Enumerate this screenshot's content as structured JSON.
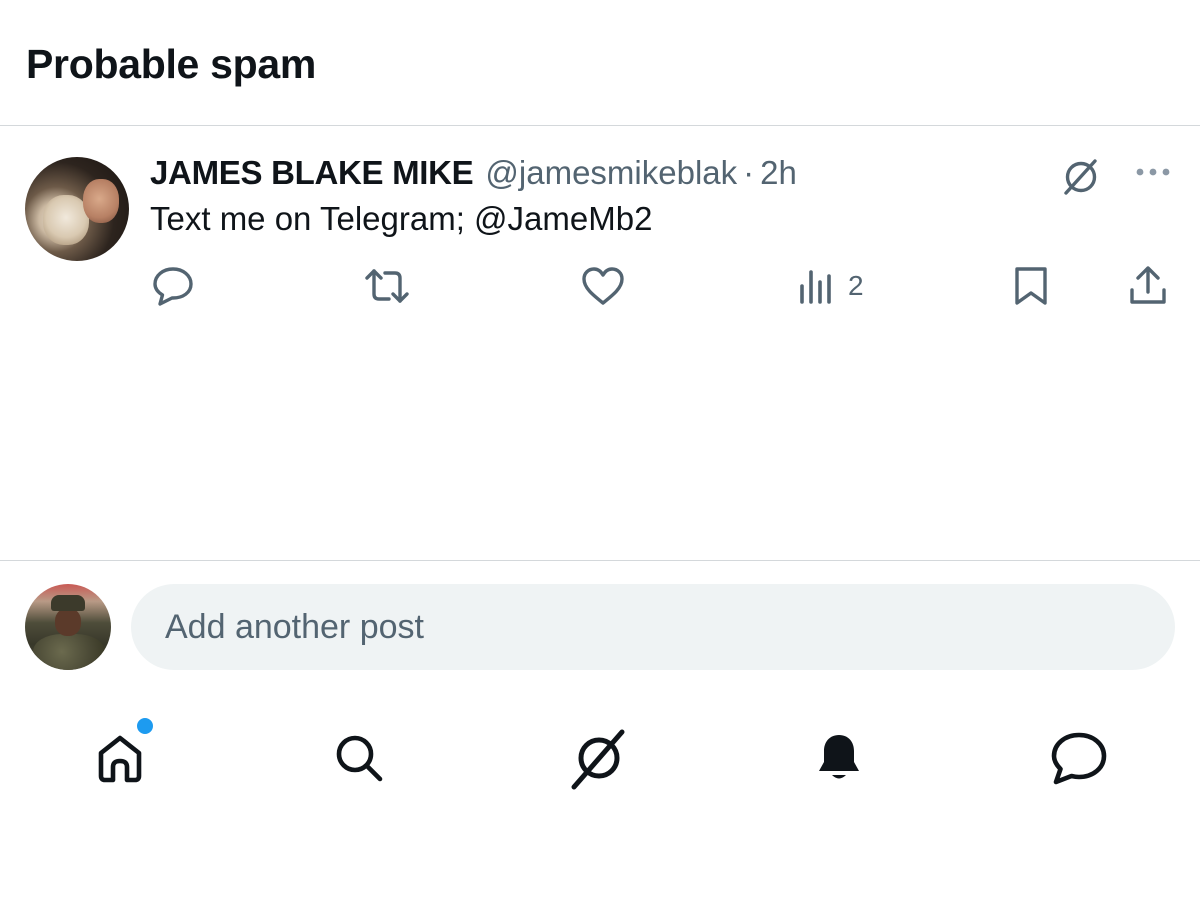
{
  "header": {
    "title": "Probable spam"
  },
  "post": {
    "author_name": "JAMES BLAKE MIKE",
    "handle": "@jamesmikeblak",
    "separator": "·",
    "time": "2h",
    "text": "Text me on Telegram; @JameMb2",
    "views": "2",
    "icons": [
      "grok-icon",
      "more-icon",
      "reply-icon",
      "repost-icon",
      "like-icon",
      "views-icon",
      "bookmark-icon",
      "share-icon"
    ]
  },
  "composer": {
    "placeholder": "Add another post"
  },
  "bottom_nav": {
    "items": [
      "home-icon",
      "search-icon",
      "grok-icon",
      "notifications-bell-icon",
      "messages-icon"
    ],
    "home_has_unread": true
  },
  "colors": {
    "text_primary": "#0f1419",
    "text_secondary": "#536471",
    "accent": "#1d9bf0",
    "input_bg": "#eff3f4",
    "divider": "#d4d8db"
  }
}
